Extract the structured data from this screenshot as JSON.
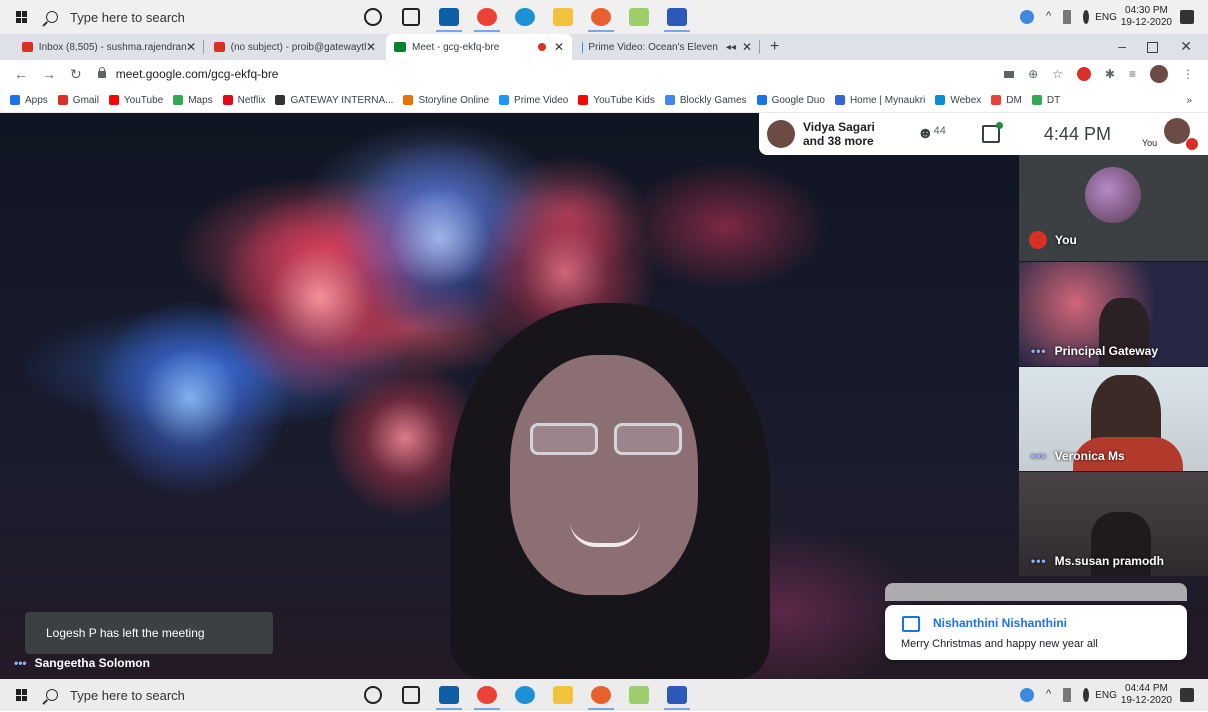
{
  "taskbar_top": {
    "search_placeholder": "Type here to search",
    "time": "04:30 PM",
    "date": "19-12-2020",
    "lang": "ENG"
  },
  "taskbar_bottom": {
    "search_placeholder": "Type here to search",
    "time": "04:44 PM",
    "date": "19-12-2020",
    "lang": "ENG"
  },
  "tabs": [
    {
      "label": "Inbox (8,505) - sushma.rajendran",
      "close": "✕"
    },
    {
      "label": "(no subject) - proib@gatewaythe",
      "close": "✕"
    },
    {
      "label": "Meet - gcg-ekfq-bre",
      "close": "✕"
    },
    {
      "label": "Prime Video: Ocean's Eleven",
      "close": "✕"
    }
  ],
  "new_tab": "+",
  "url": "meet.google.com/gcg-ekfq-bre",
  "bookmarks": [
    {
      "label": "Apps",
      "color": "#1a73e8"
    },
    {
      "label": "Gmail",
      "color": "#d93025"
    },
    {
      "label": "YouTube",
      "color": "#ff0000"
    },
    {
      "label": "Maps",
      "color": "#34a853"
    },
    {
      "label": "Netflix",
      "color": "#e50914"
    },
    {
      "label": "GATEWAY INTERNA...",
      "color": "#333333"
    },
    {
      "label": "Storyline Online",
      "color": "#e8710a"
    },
    {
      "label": "Prime Video",
      "color": "#1a98ff"
    },
    {
      "label": "YouTube Kids",
      "color": "#ff0000"
    },
    {
      "label": "Blockly Games",
      "color": "#4285f4"
    },
    {
      "label": "Google Duo",
      "color": "#1a73e8"
    },
    {
      "label": "Home | Mynaukri",
      "color": "#3367d6"
    },
    {
      "label": "Webex",
      "color": "#0a8fd4"
    },
    {
      "label": "DM",
      "color": "#ea4335"
    },
    {
      "label": "DT",
      "color": "#34a853"
    }
  ],
  "bookmarks_more": "»",
  "meet": {
    "presenters": "Vidya Sagari",
    "presenters_more": "and 38 more",
    "participant_count": "44",
    "time": "4:44 PM",
    "self_label": "You",
    "left_notice": "Logesh P has left the meeting",
    "main_speaker": "Sangeetha Solomon",
    "tiles": [
      {
        "name": "You",
        "muted": true
      },
      {
        "name": "Principal Gateway"
      },
      {
        "name": "Veronica Ms"
      },
      {
        "name": "Ms.susan pramodh"
      }
    ],
    "chat": {
      "sender": "Nishanthini Nishanthini",
      "message": "Merry Christmas and happy new year all"
    }
  }
}
